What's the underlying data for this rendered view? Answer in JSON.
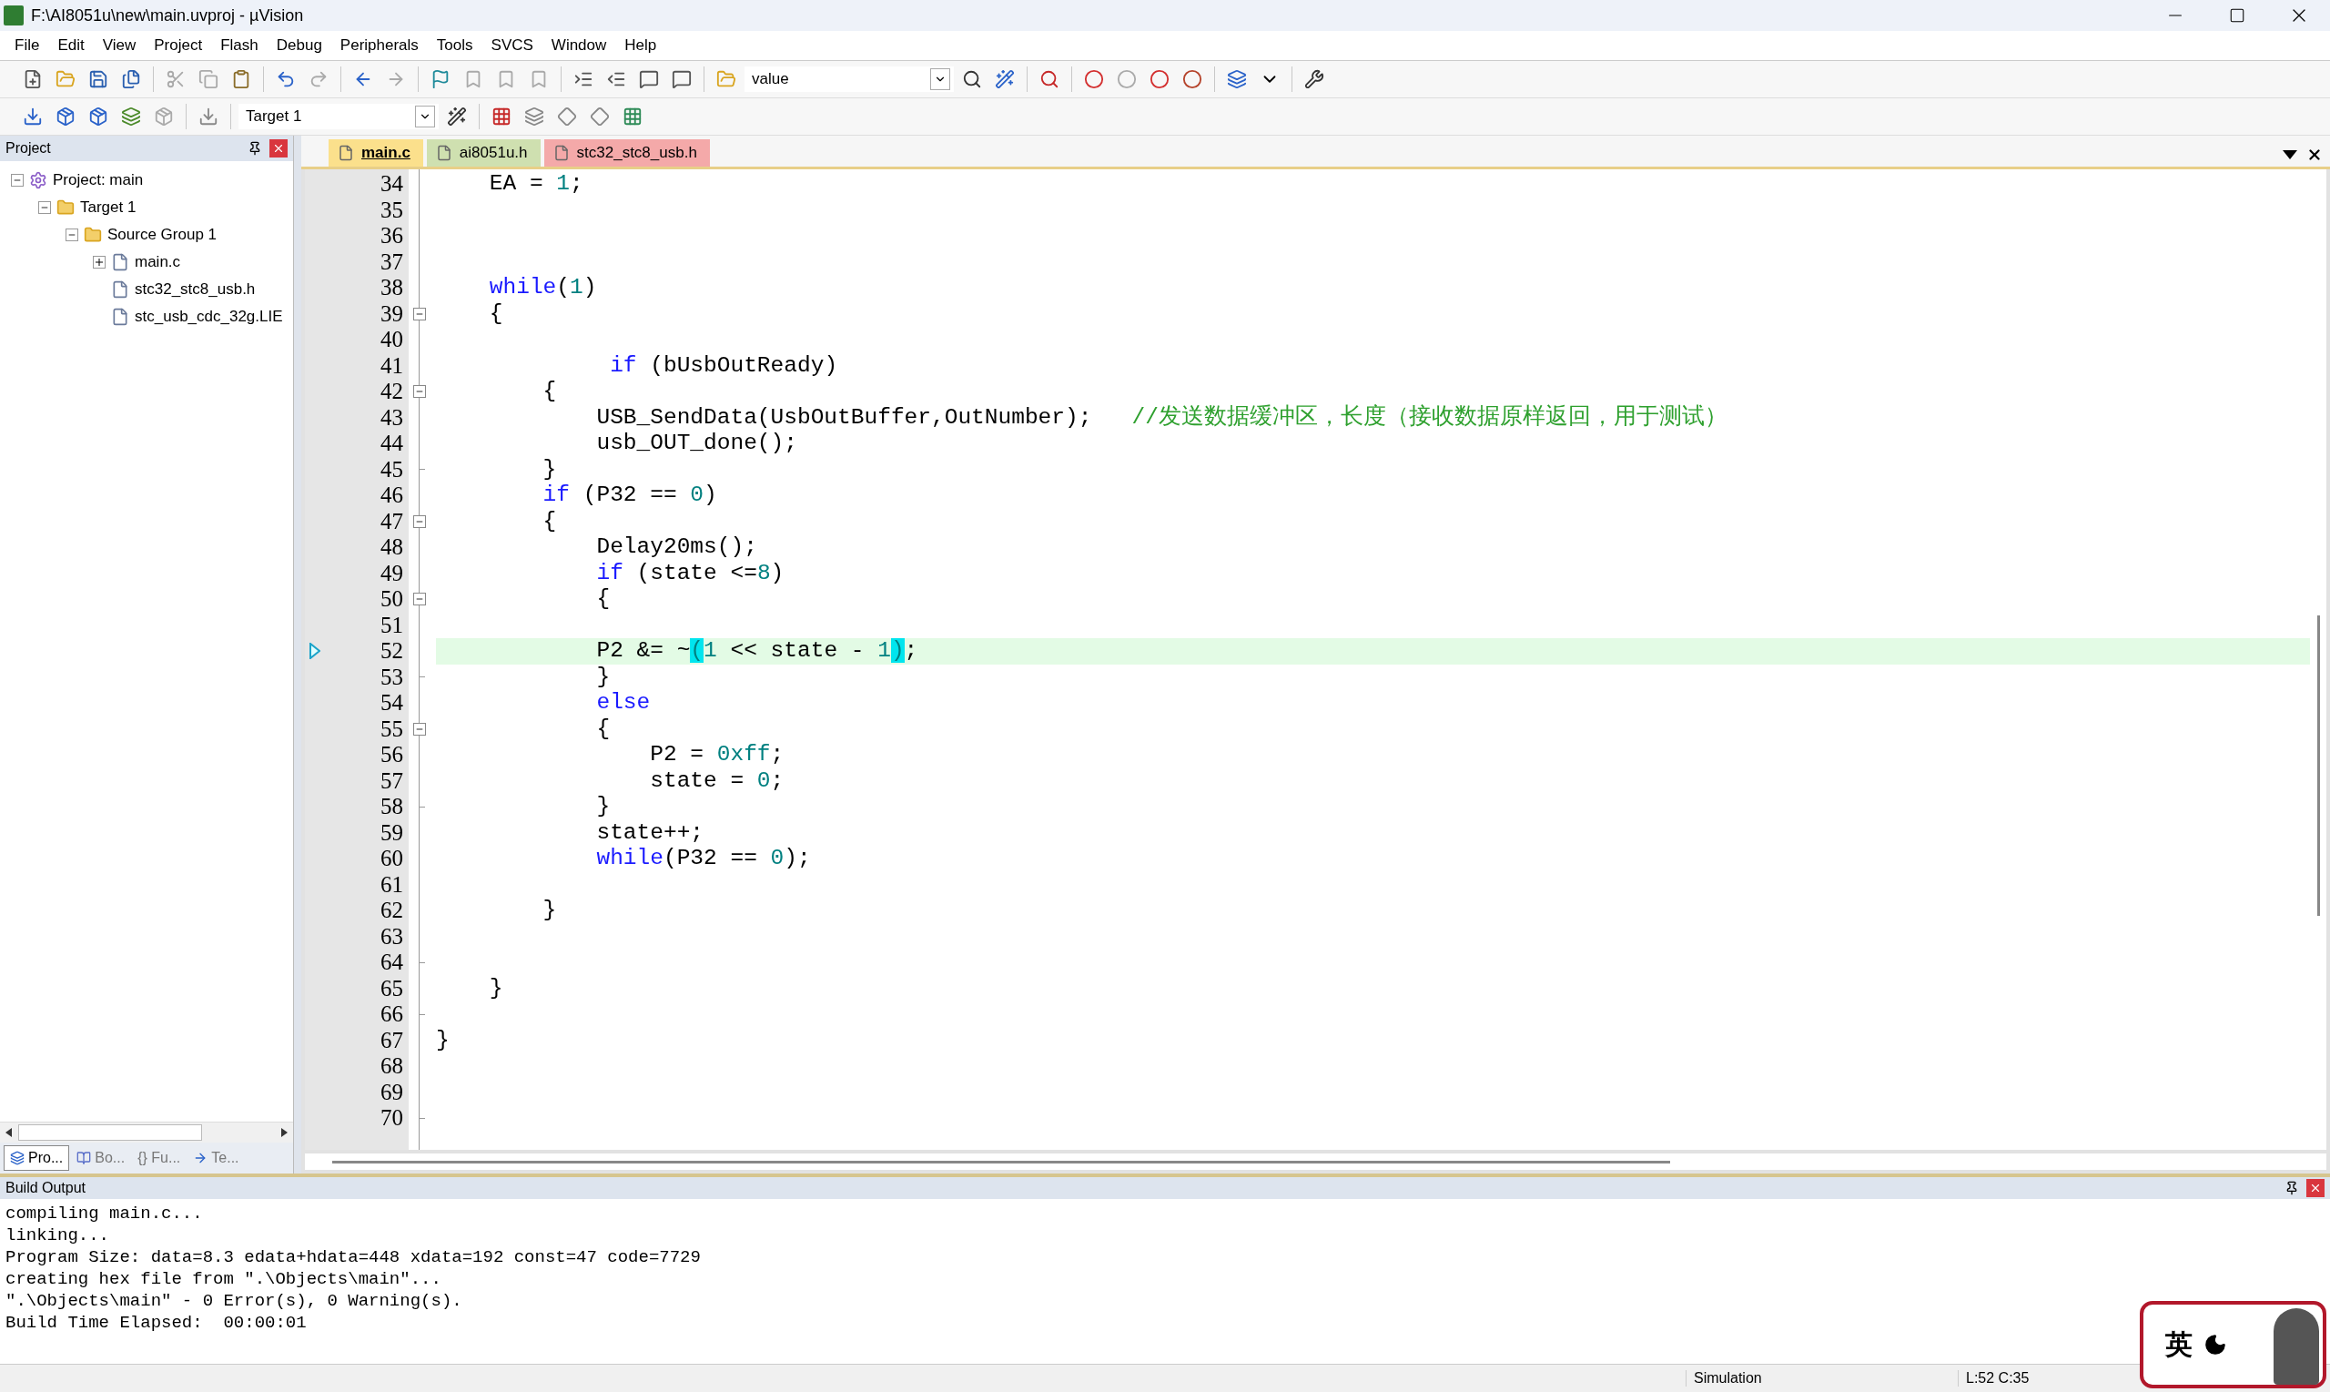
{
  "window": {
    "title": "F:\\AI8051u\\new\\main.uvproj - µVision"
  },
  "menu": [
    "File",
    "Edit",
    "View",
    "Project",
    "Flash",
    "Debug",
    "Peripherals",
    "Tools",
    "SVCS",
    "Window",
    "Help"
  ],
  "toolbar": {
    "find_value": "value",
    "target": "Target 1"
  },
  "project_panel": {
    "title": "Project",
    "tree": [
      {
        "label": "Project: main",
        "kind": "project",
        "expanded": true,
        "children": [
          {
            "label": "Target 1",
            "kind": "target",
            "expanded": true,
            "children": [
              {
                "label": "Source Group 1",
                "kind": "group",
                "expanded": true,
                "children": [
                  {
                    "label": "main.c",
                    "kind": "file",
                    "expanded": false
                  },
                  {
                    "label": "stc32_stc8_usb.h",
                    "kind": "file"
                  },
                  {
                    "label": "stc_usb_cdc_32g.LIE",
                    "kind": "file"
                  }
                ]
              }
            ]
          }
        ]
      }
    ],
    "tabs": [
      {
        "label": "Pro...",
        "kind": "project",
        "selected": true
      },
      {
        "label": "Bo...",
        "kind": "books",
        "selected": false
      },
      {
        "label": "{} Fu...",
        "kind": "functions",
        "selected": false
      },
      {
        "label": "Te...",
        "kind": "templates",
        "selected": false
      }
    ]
  },
  "editor": {
    "tabs": [
      {
        "label": "main.c",
        "selected": true,
        "color": "#fbe08c"
      },
      {
        "label": "ai8051u.h",
        "selected": false,
        "color": "#cfe0b0"
      },
      {
        "label": "stc32_stc8_usb.h",
        "selected": false,
        "color": "#f4a9a9"
      }
    ],
    "lines": [
      {
        "n": "34",
        "fold_start": false,
        "fold_end": false,
        "current": false,
        "segs": [
          {
            "kind": "plain",
            "text": "    EA = "
          },
          {
            "kind": "number",
            "text": "1"
          },
          {
            "kind": "plain",
            "text": ";"
          }
        ]
      },
      {
        "n": "35",
        "fold_start": false,
        "fold_end": false,
        "current": false
      },
      {
        "n": "36",
        "fold_start": false,
        "fold_end": false,
        "current": false
      },
      {
        "n": "37",
        "fold_start": false,
        "fold_end": false,
        "current": false
      },
      {
        "n": "38",
        "fold_start": false,
        "fold_end": false,
        "current": false,
        "segs": [
          {
            "kind": "keyword",
            "text": "    while"
          },
          {
            "kind": "plain",
            "text": "("
          },
          {
            "kind": "number",
            "text": "1"
          },
          {
            "kind": "plain",
            "text": ")"
          }
        ]
      },
      {
        "n": "39",
        "fold_start": true,
        "fold_end": false,
        "current": false,
        "segs": [
          {
            "kind": "plain",
            "text": "    {"
          }
        ]
      },
      {
        "n": "40",
        "fold_start": false,
        "fold_end": false,
        "current": false
      },
      {
        "n": "41",
        "fold_start": false,
        "fold_end": false,
        "current": false,
        "segs": [
          {
            "kind": "keyword",
            "text": "             if"
          },
          {
            "kind": "plain",
            "text": " (bUsbOutReady)"
          }
        ]
      },
      {
        "n": "42",
        "fold_start": true,
        "fold_end": false,
        "current": false,
        "segs": [
          {
            "kind": "plain",
            "text": "        {"
          }
        ]
      },
      {
        "n": "43",
        "fold_start": false,
        "fold_end": false,
        "current": false,
        "segs": [
          {
            "kind": "plain",
            "text": "            USB_SendData(UsbOutBuffer,OutNumber);   "
          },
          {
            "kind": "comment",
            "text": "//发送数据缓冲区，长度（接收数据原样返回，用于测试）"
          }
        ]
      },
      {
        "n": "44",
        "fold_start": false,
        "fold_end": false,
        "current": false,
        "segs": [
          {
            "kind": "plain",
            "text": "            usb_OUT_done();"
          }
        ]
      },
      {
        "n": "45",
        "fold_start": false,
        "fold_end": true,
        "current": false,
        "segs": [
          {
            "kind": "plain",
            "text": "        }"
          }
        ]
      },
      {
        "n": "46",
        "fold_start": false,
        "fold_end": false,
        "current": false,
        "segs": [
          {
            "kind": "keyword",
            "text": "        if"
          },
          {
            "kind": "plain",
            "text": " (P32 == "
          },
          {
            "kind": "number",
            "text": "0"
          },
          {
            "kind": "plain",
            "text": ")"
          }
        ]
      },
      {
        "n": "47",
        "fold_start": true,
        "fold_end": false,
        "current": false,
        "segs": [
          {
            "kind": "plain",
            "text": "        {"
          }
        ]
      },
      {
        "n": "48",
        "fold_start": false,
        "fold_end": false,
        "current": false,
        "segs": [
          {
            "kind": "plain",
            "text": "            Delay20ms();"
          }
        ]
      },
      {
        "n": "49",
        "fold_start": false,
        "fold_end": false,
        "current": false,
        "segs": [
          {
            "kind": "keyword",
            "text": "            if"
          },
          {
            "kind": "plain",
            "text": " (state <="
          },
          {
            "kind": "number",
            "text": "8"
          },
          {
            "kind": "plain",
            "text": ")"
          }
        ]
      },
      {
        "n": "50",
        "fold_start": true,
        "fold_end": false,
        "current": false,
        "segs": [
          {
            "kind": "plain",
            "text": "            {"
          }
        ]
      },
      {
        "n": "51",
        "fold_start": false,
        "fold_end": false,
        "current": false
      },
      {
        "n": "52",
        "fold_start": false,
        "fold_end": false,
        "current": true,
        "segs": [
          {
            "kind": "plain",
            "text": "            P2 &= ~"
          },
          {
            "kind": "brace_match",
            "text": "("
          },
          {
            "kind": "number",
            "text": "1"
          },
          {
            "kind": "plain",
            "text": " << state - "
          },
          {
            "kind": "number",
            "text": "1"
          },
          {
            "kind": "brace_match",
            "text": ")"
          },
          {
            "kind": "plain",
            "text": ";"
          }
        ]
      },
      {
        "n": "53",
        "fold_start": false,
        "fold_end": true,
        "current": false,
        "segs": [
          {
            "kind": "plain",
            "text": "            }"
          }
        ]
      },
      {
        "n": "54",
        "fold_start": false,
        "fold_end": false,
        "current": false,
        "segs": [
          {
            "kind": "keyword",
            "text": "            else"
          }
        ]
      },
      {
        "n": "55",
        "fold_start": true,
        "fold_end": false,
        "current": false,
        "segs": [
          {
            "kind": "plain",
            "text": "            {"
          }
        ]
      },
      {
        "n": "56",
        "fold_start": false,
        "fold_end": false,
        "current": false,
        "segs": [
          {
            "kind": "plain",
            "text": "                P2 = "
          },
          {
            "kind": "number",
            "text": "0xff"
          },
          {
            "kind": "plain",
            "text": ";"
          }
        ]
      },
      {
        "n": "57",
        "fold_start": false,
        "fold_end": false,
        "current": false,
        "segs": [
          {
            "kind": "plain",
            "text": "                state = "
          },
          {
            "kind": "number",
            "text": "0"
          },
          {
            "kind": "plain",
            "text": ";"
          }
        ]
      },
      {
        "n": "58",
        "fold_start": false,
        "fold_end": true,
        "current": false,
        "segs": [
          {
            "kind": "plain",
            "text": "            }"
          }
        ]
      },
      {
        "n": "59",
        "fold_start": false,
        "fold_end": false,
        "current": false,
        "segs": [
          {
            "kind": "plain",
            "text": "            state++;"
          }
        ]
      },
      {
        "n": "60",
        "fold_start": false,
        "fold_end": false,
        "current": false,
        "segs": [
          {
            "kind": "keyword",
            "text": "            while"
          },
          {
            "kind": "plain",
            "text": "(P32 == "
          },
          {
            "kind": "number",
            "text": "0"
          },
          {
            "kind": "plain",
            "text": ");"
          }
        ]
      },
      {
        "n": "61",
        "fold_start": false,
        "fold_end": false,
        "current": false
      },
      {
        "n": "62",
        "fold_start": false,
        "fold_end": false,
        "current": false,
        "segs": [
          {
            "kind": "plain",
            "text": "        }"
          }
        ]
      },
      {
        "n": "63",
        "fold_start": false,
        "fold_end": false,
        "current": false
      },
      {
        "n": "64",
        "fold_start": false,
        "fold_end": true,
        "current": false
      },
      {
        "n": "65",
        "fold_start": false,
        "fold_end": false,
        "current": false,
        "segs": [
          {
            "kind": "plain",
            "text": "    }"
          }
        ]
      },
      {
        "n": "66",
        "fold_start": false,
        "fold_end": true,
        "current": false
      },
      {
        "n": "67",
        "fold_start": false,
        "fold_end": false,
        "current": false,
        "segs": [
          {
            "kind": "plain",
            "text": "}"
          }
        ]
      },
      {
        "n": "68",
        "fold_start": false,
        "fold_end": false,
        "current": false
      },
      {
        "n": "69",
        "fold_start": false,
        "fold_end": false,
        "current": false
      },
      {
        "n": "70",
        "fold_start": false,
        "fold_end": true,
        "current": false
      }
    ]
  },
  "build_output": {
    "title": "Build Output",
    "lines": [
      "compiling main.c...",
      "linking...",
      "Program Size: data=8.3 edata+hdata=448 xdata=192 const=47 code=7729",
      "creating hex file from \".\\Objects\\main\"...",
      "\".\\Objects\\main\" - 0 Error(s), 0 Warning(s).",
      "Build Time Elapsed:  00:00:01"
    ]
  },
  "status_bar": {
    "mode": "Simulation",
    "position": "L:52 C:35"
  },
  "ime": {
    "label": "英"
  }
}
